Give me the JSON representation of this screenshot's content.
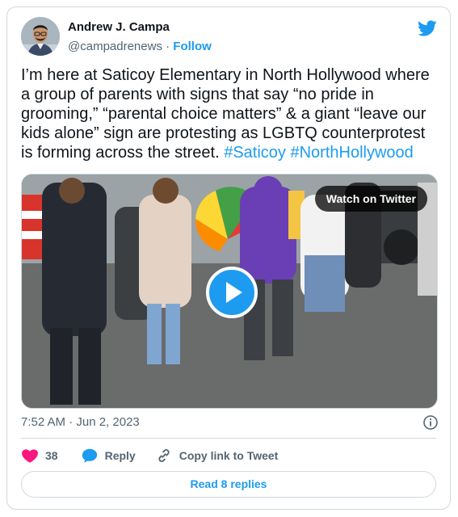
{
  "author": {
    "name": "Andrew J. Campa",
    "handle": "@campadrenews",
    "separator": "·",
    "follow_label": "Follow"
  },
  "tweet": {
    "text": "I’m here at Saticoy Elementary in North Hollywood where a group of parents with signs that say “no pride in grooming,” “parental choice matters” & a giant “leave our kids alone” sign are protesting as LGBTQ counterprotest is forming across the street. ",
    "hashtags": [
      "#Saticoy",
      "#NorthHollywood"
    ],
    "timestamp": "7:52 AM · Jun 2, 2023"
  },
  "media": {
    "watch_label": "Watch on Twitter",
    "icon": "play-icon"
  },
  "actions": {
    "likes_count": "38",
    "reply_label": "Reply",
    "copy_label": "Copy link to Tweet"
  },
  "footer": {
    "read_replies_label": "Read 8 replies"
  },
  "colors": {
    "accent": "#1d9bf0",
    "like": "#f91880",
    "text": "#0f1419",
    "muted": "#536471",
    "border": "#cfd9de"
  }
}
